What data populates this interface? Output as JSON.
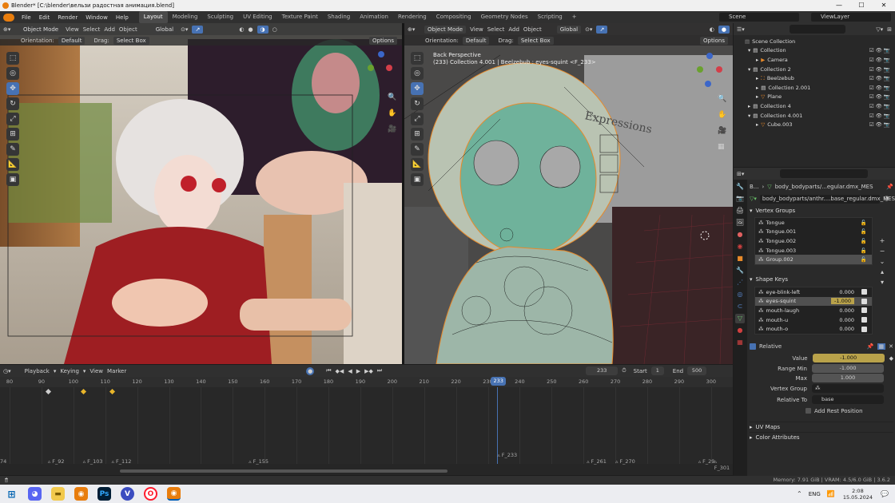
{
  "window": {
    "title": "Blender* [C:\\blender\\вельзи радостная анимация.blend]",
    "minimize": "—",
    "maximize": "☐",
    "close": "✕"
  },
  "menu": {
    "items": [
      "File",
      "Edit",
      "Render",
      "Window",
      "Help"
    ]
  },
  "workspaces": [
    "Layout",
    "Modeling",
    "Sculpting",
    "UV Editing",
    "Texture Paint",
    "Shading",
    "Animation",
    "Rendering",
    "Compositing",
    "Geometry Nodes",
    "Scripting"
  ],
  "scene": {
    "label": "Scene",
    "view_layer": "ViewLayer"
  },
  "viewport_left": {
    "mode": "Object Mode",
    "menus": [
      "View",
      "Select",
      "Add",
      "Object"
    ],
    "transform": "Global",
    "orientation_label": "Orientation:",
    "orientation": "Default",
    "drag_label": "Drag:",
    "drag": "Select Box",
    "options": "Options"
  },
  "viewport_right": {
    "mode": "Object Mode",
    "menus": [
      "View",
      "Select",
      "Add",
      "Object"
    ],
    "transform": "Global",
    "orientation_label": "Orientation:",
    "orientation": "Default",
    "drag_label": "Drag:",
    "drag": "Select Box",
    "options": "Options",
    "perspective": "Back Perspective",
    "info": "(233) Collection 4.001 | Beelzebub : eyes-squint <F_233>",
    "wall_text": "Expressions"
  },
  "outliner": {
    "search_placeholder": "",
    "rows": [
      {
        "label": "Scene Collection",
        "indent": 0
      },
      {
        "label": "Collection",
        "indent": 1
      },
      {
        "label": "Camera",
        "indent": 2
      },
      {
        "label": "Collection 2",
        "indent": 1
      },
      {
        "label": "Beelzebub",
        "indent": 2
      },
      {
        "label": "Collection 2.001",
        "indent": 2
      },
      {
        "label": "Plane",
        "indent": 2
      },
      {
        "label": "Collection 4",
        "indent": 1
      },
      {
        "label": "Collection 4.001",
        "indent": 1
      },
      {
        "label": "Cube.003",
        "indent": 2
      }
    ]
  },
  "properties": {
    "breadcrumb_root": "B...",
    "breadcrumb_mesh": "body_bodyparts/...egular.dmx_MES",
    "mesh_name": "body_bodyparts/anthr....base_regular.dmx_MES",
    "vertex_groups_title": "Vertex Groups",
    "vertex_groups": [
      "Tongue",
      "Tongue.001",
      "Tongue.002",
      "Tongue.003",
      "Group.002"
    ],
    "shape_keys_title": "Shape Keys",
    "shape_keys": [
      {
        "name": "eye-blink-left",
        "value": "0.000"
      },
      {
        "name": "eyes-squint",
        "value": "-1.000"
      },
      {
        "name": "mouth-laugh",
        "value": "0.000"
      },
      {
        "name": "mouth-u",
        "value": "0.000"
      },
      {
        "name": "mouth-o",
        "value": "0.000"
      }
    ],
    "relative_label": "Relative",
    "value_label": "Value",
    "value": "-1.000",
    "range_min_label": "Range Min",
    "range_min": "-1.000",
    "max_label": "Max",
    "max": "1.000",
    "vertex_group_label": "Vertex Group",
    "relative_to_label": "Relative To",
    "relative_to": "base",
    "add_rest_label": "Add Rest Position",
    "uv_maps": "UV Maps",
    "color_attributes": "Color Attributes"
  },
  "timeline": {
    "menus": [
      "Playback",
      "Keying",
      "View",
      "Marker"
    ],
    "current_frame": "233",
    "start_label": "Start",
    "start": "1",
    "end_label": "End",
    "end": "500",
    "ticks": [
      "80",
      "90",
      "100",
      "110",
      "120",
      "130",
      "140",
      "150",
      "160",
      "170",
      "180",
      "190",
      "200",
      "210",
      "220",
      "230",
      "240",
      "250",
      "260",
      "270",
      "280",
      "290",
      "300"
    ],
    "markers": [
      "74",
      "F_92",
      "F_103",
      "F_112",
      "F_155",
      "F_233",
      "F_261",
      "F_270",
      "F_29",
      "F_301"
    ]
  },
  "status": {
    "memory": "Memory: 7.91 GiB | VRAM: 4.5/6.0 GiB | 3.6.2"
  },
  "taskbar": {
    "lang": "ENG",
    "time": "2:08",
    "date": "15.05.2024",
    "icons": [
      "windows-start",
      "discord",
      "file-explorer",
      "blender",
      "photoshop",
      "vivaldi",
      "opera",
      "blender-active"
    ]
  }
}
